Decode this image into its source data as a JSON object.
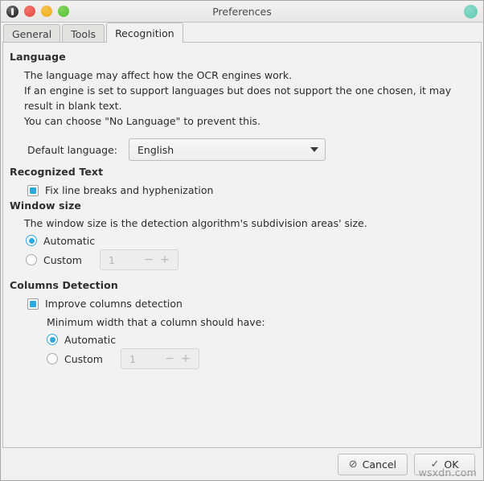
{
  "titlebar": {
    "title": "Preferences",
    "app_icon": "app-icon",
    "close_dot": "close-button",
    "minimize_dot": "minimize-button",
    "maximize_dot": "maximize-button",
    "right_indicator": "status-indicator"
  },
  "tabs": [
    {
      "label": "General",
      "active": false
    },
    {
      "label": "Tools",
      "active": false
    },
    {
      "label": "Recognition",
      "active": true
    }
  ],
  "sections": {
    "language": {
      "title": "Language",
      "paragraph_lines": [
        "The language may affect how the OCR engines work.",
        "If an engine is set to support languages but does not support the one chosen, it may result in blank text.",
        "You can choose \"No Language\" to prevent this."
      ],
      "default_language_label": "Default language:",
      "default_language_value": "English",
      "caret_icon": "chevron-down-icon"
    },
    "recognized_text": {
      "title": "Recognized Text",
      "fix_line_breaks_label": "Fix line breaks and hyphenization",
      "fix_line_breaks_checked": true
    },
    "window_size": {
      "title": "Window size",
      "description": "The window size is the detection algorithm's subdivision areas' size.",
      "automatic_label": "Automatic",
      "custom_label": "Custom",
      "selected": "Automatic",
      "spin_value": "1",
      "spin_minus": "−",
      "spin_plus": "+",
      "spin_disabled": true
    },
    "columns_detection": {
      "title": "Columns Detection",
      "improve_label": "Improve columns detection",
      "improve_checked": true,
      "min_width_label": "Minimum width that a column should have:",
      "automatic_label": "Automatic",
      "custom_label": "Custom",
      "selected": "Automatic",
      "spin_value": "1",
      "spin_minus": "−",
      "spin_plus": "+",
      "spin_disabled": true
    }
  },
  "footer": {
    "cancel_label": "Cancel",
    "cancel_icon": "⊘",
    "ok_label": "OK",
    "ok_icon": "✓"
  },
  "watermark": "wsxdn.com",
  "colors": {
    "accent": "#2ea9e0",
    "close": "#e8564c",
    "minimize": "#f0b323",
    "maximize": "#63c63f",
    "indicator": "#6ecfba",
    "panel_bg": "#f2f2f2"
  }
}
